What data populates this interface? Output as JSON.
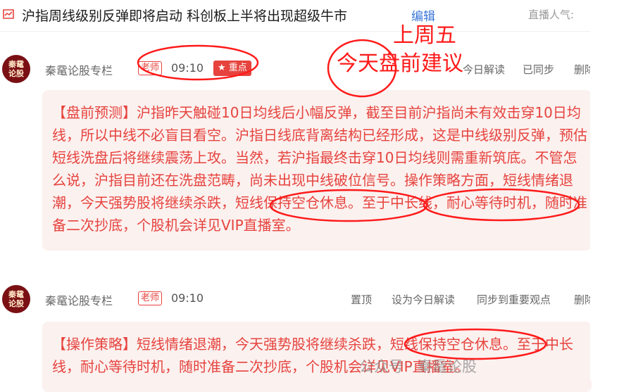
{
  "header": {
    "title": "沪指周线级别反弹即将启动 科创板上半将出现超级牛市",
    "edit_label": "编辑",
    "popularity_label": "直播人气:"
  },
  "posts": [
    {
      "author": "秦鼋论股专栏",
      "role": "老师",
      "time": "09:10",
      "featured": "★ 重点",
      "actions": [
        "今日解读",
        "已同步",
        "删除"
      ],
      "content": "【盘前预测】沪指昨天触碰10日均线后小幅反弹，截至目前沪指尚未有效击穿10日均线，所以中线不必盲目看空。沪指日线底背离结构已经形成，这是中线级别反弹，预估短线洗盘后将继续震荡上攻。当然，若沪指最终击穿10日均线则需重新筑底。不管怎么说，沪指目前还在洗盘范畴，尚未出现中线破位信号。操作策略方面，短线情绪退潮，今天强势股将继续杀跌，短线保持空仓休息。至于中长线，耐心等待时机，随时准备二次抄底，个股机会详见VIP直播室。"
    },
    {
      "author": "秦鼋论股专栏",
      "role": "老师",
      "time": "09:10",
      "actions": [
        "置顶",
        "设为今日解读",
        "同步到重要观点",
        "删除"
      ],
      "content": "【操作策略】短线情绪退潮，今天强势股将继续杀跌，短线保持空仓休息。至于中长线，耐心等待时机，随时准备二次抄底，个股机会详见VIP直播室。"
    }
  ],
  "avatar_text": [
    "秦鼋",
    "论股"
  ],
  "annotations": {
    "line1": "上周五",
    "line2": "今天盘前建议",
    "color": "#ff1a1a"
  },
  "watermark": "公众号 · 秦鼋论股",
  "colors": {
    "accent": "#e6433e",
    "link": "#3a76d8",
    "bubble_bg": "#fbf1ef"
  }
}
